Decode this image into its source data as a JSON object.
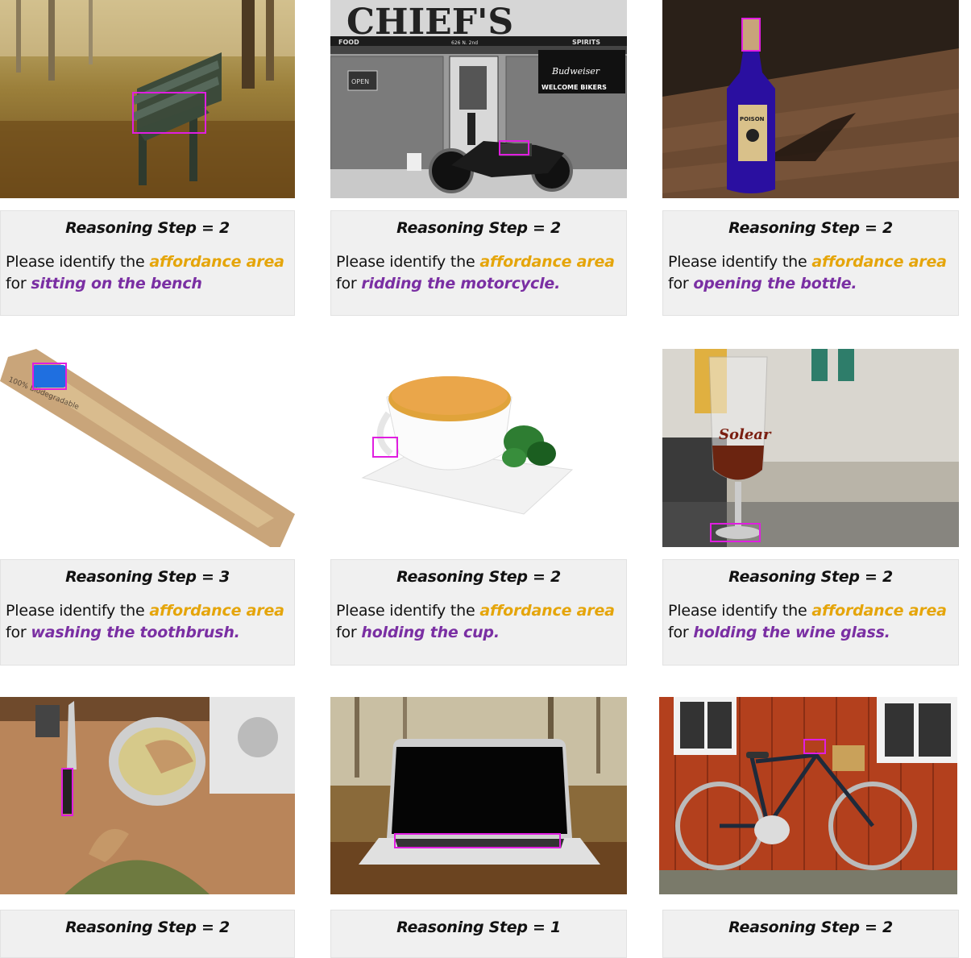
{
  "colors": {
    "highlight_affordance": "#e5a50a",
    "highlight_action": "#7a2fa3",
    "bbox": "#e01ee0",
    "caption_bg": "#f0f0f0"
  },
  "cards": [
    {
      "step": "Reasoning Step = 2",
      "prefix": "Please identify the",
      "affordance": "affordance area",
      "for": "for",
      "action": "sitting on the bench",
      "scene_text": []
    },
    {
      "step": "Reasoning Step = 2",
      "prefix": "Please identify the",
      "affordance": "affordance area",
      "for": "for",
      "action": "ridding the motorcycle.",
      "scene_text": [
        "CHIEF'S",
        "FOOD",
        "626 N. 2nd",
        "SPIRITS",
        "OPEN",
        "Budweiser",
        "WELCOME BIKERS"
      ]
    },
    {
      "step": "Reasoning Step = 2",
      "prefix": "Please identify the",
      "affordance": "affordance area",
      "for": "for",
      "action": "opening the bottle.",
      "scene_text": [
        "POISON"
      ]
    },
    {
      "step": "Reasoning Step = 3",
      "prefix": "Please identify the",
      "affordance": "affordance area",
      "for": "for",
      "action": "washing the toothbrush.",
      "scene_text": [
        "100% biodegradable"
      ]
    },
    {
      "step": "Reasoning Step = 2",
      "prefix": "Please identify the",
      "affordance": "affordance area",
      "for": "for",
      "action": "holding the cup.",
      "scene_text": []
    },
    {
      "step": "Reasoning Step = 2",
      "prefix": "Please identify the",
      "affordance": "affordance area",
      "for": "for",
      "action": "holding the wine glass.",
      "scene_text": [
        "Solear"
      ]
    },
    {
      "step": "Reasoning Step = 2",
      "scene_text": []
    },
    {
      "step": "Reasoning Step = 1",
      "scene_text": []
    },
    {
      "step": "Reasoning Step = 2",
      "scene_text": []
    }
  ]
}
